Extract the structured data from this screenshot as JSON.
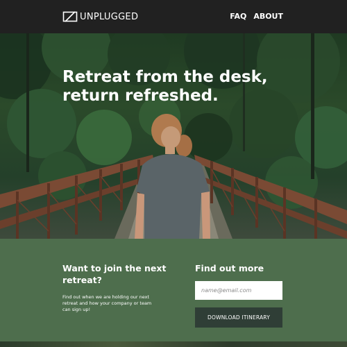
{
  "nav": {
    "brand": "UNPLUGGED",
    "logo_icon": "unplugged-box-icon",
    "links": [
      {
        "label": "FAQ"
      },
      {
        "label": "ABOUT"
      }
    ]
  },
  "hero": {
    "heading": "Retreat from the desk, return refreshed.",
    "image": "forest-bridge-photo"
  },
  "cta": {
    "join_title": "Want to join the next retreat?",
    "join_desc": "Find out when we are holding our next retreat and how your company or team can sign up!",
    "find_title": "Find out more",
    "email_placeholder": "name@email.com",
    "button_label": "DOWNLOAD ITINERARY"
  },
  "colors": {
    "navbar": "#212121",
    "cta_background": "#4e6e4d",
    "button_background": "#2f3e36",
    "text": "#ffffff"
  }
}
